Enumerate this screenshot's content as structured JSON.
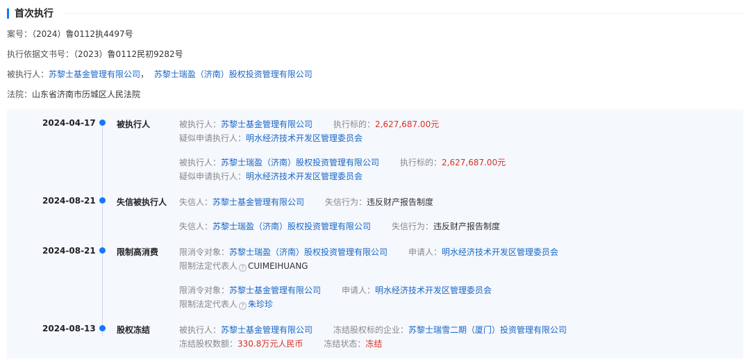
{
  "section": {
    "title": "首次执行"
  },
  "info": {
    "case_no_label": "案号：",
    "case_no": "（2024）鲁0112执4497号",
    "basis_label": "执行依据文书号：",
    "basis": "（2023）鲁0112民初9282号",
    "executed_label": "被执行人：",
    "executed_1": "苏黎士基金管理有限公司",
    "executed_sep": "，",
    "executed_2": "苏黎士瑞盈（济南）股权投资管理有限公司",
    "court_label": "法院：",
    "court": "山东省济南市历城区人民法院"
  },
  "timeline": [
    {
      "date": "2024-04-17",
      "type": "被执行人",
      "entries": [
        {
          "l1": {
            "a_label": "被执行人：",
            "a_value": "苏黎士基金管理有限公司",
            "b_label": "执行标的：",
            "b_value": "2,627,687.00元"
          },
          "l2": {
            "label": "疑似申请执行人：",
            "value": "明水经济技术开发区管理委员会"
          }
        },
        {
          "l1": {
            "a_label": "被执行人：",
            "a_value": "苏黎士瑞盈（济南）股权投资管理有限公司",
            "b_label": "执行标的：",
            "b_value": "2,627,687.00元"
          },
          "l2": {
            "label": "疑似申请执行人：",
            "value": "明水经济技术开发区管理委员会"
          }
        }
      ]
    },
    {
      "date": "2024-08-21",
      "type": "失信被执行人",
      "entries": [
        {
          "l1": {
            "a_label": "失信人：",
            "a_value": "苏黎士基金管理有限公司",
            "b_label": "失信行为：",
            "b_value": "违反财产报告制度"
          }
        },
        {
          "l1": {
            "a_label": "失信人：",
            "a_value": "苏黎士瑞盈（济南）股权投资管理有限公司",
            "b_label": "失信行为：",
            "b_value": "违反财产报告制度"
          }
        }
      ]
    },
    {
      "date": "2024-08-21",
      "type": "限制高消费",
      "entries": [
        {
          "l1": {
            "a_label": "限消令对象：",
            "a_value": "苏黎士瑞盈（济南）股权投资管理有限公司",
            "b_label": "申请人：",
            "b_value": "明水经济技术开发区管理委员会"
          },
          "l2": {
            "label": "限制法定代表人",
            "value": "CUIMEIHUANG"
          }
        },
        {
          "l1": {
            "a_label": "限消令对象：",
            "a_value": "苏黎士基金管理有限公司",
            "b_label": "申请人：",
            "b_value": "明水经济技术开发区管理委员会"
          },
          "l2": {
            "label": "限制法定代表人",
            "value": "朱珍珍"
          }
        }
      ]
    },
    {
      "date": "2024-08-13",
      "type": "股权冻结",
      "entries": [
        {
          "l1": {
            "a_label": "被执行人：",
            "a_value": "苏黎士基金管理有限公司",
            "b_label": "冻结股权标的企业：",
            "b_value": "苏黎士瑞雪二期（厦门）投资管理有限公司"
          },
          "l2": {
            "label": "冻结股权数额：",
            "value": "330.8万元人民币",
            "c_label": "冻结状态：",
            "c_value": "冻结"
          }
        }
      ]
    }
  ],
  "colors": {
    "accent": "#1677ff",
    "link": "#1a66c5",
    "amount": "#d93026",
    "timeline_bg": "#f5f8fd"
  },
  "icons": {
    "help": "question-circle-icon"
  }
}
